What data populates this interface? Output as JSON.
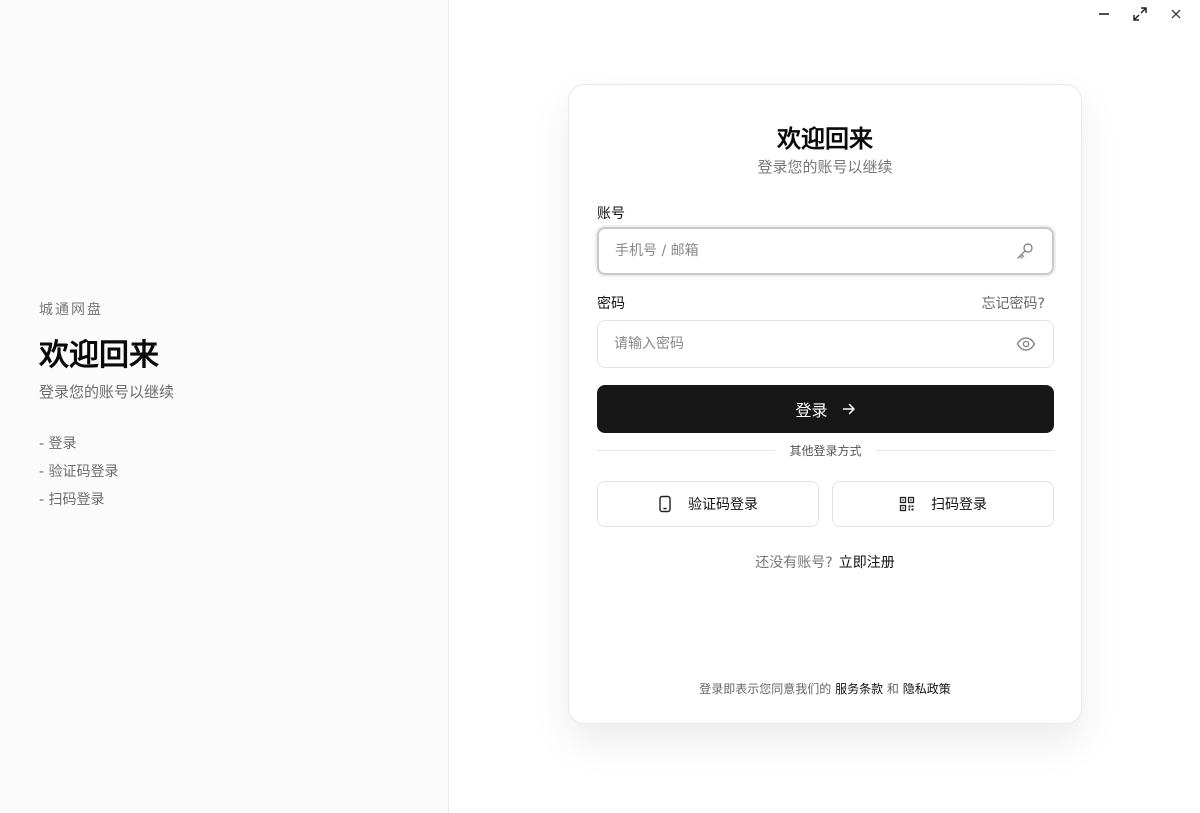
{
  "left": {
    "brand": "城通网盘",
    "title": "欢迎回来",
    "subtitle": "登录您的账号以继续",
    "features": [
      "- 登录",
      "- 验证码登录",
      "- 扫码登录"
    ]
  },
  "window_controls": {
    "minimize_icon": "minimize-icon",
    "maximize_icon": "maximize-icon",
    "close_icon": "close-icon"
  },
  "card": {
    "title": "欢迎回来",
    "subtitle": "登录您的账号以继续",
    "account": {
      "label": "账号",
      "placeholder": "手机号 / 邮箱",
      "value": "",
      "icon": "key-icon"
    },
    "password": {
      "label": "密码",
      "forgot": "忘记密码?",
      "placeholder": "请输入密码",
      "value": "",
      "icon": "eye-icon"
    },
    "login_button": "登录",
    "divider_text": "其他登录方式",
    "sms_login": "验证码登录",
    "qr_login": "扫码登录",
    "signup_prompt": "还没有账号?",
    "signup_link": "立即注册",
    "terms_prefix": "登录即表示您同意我们的",
    "terms_link": "服务条款",
    "terms_and": "和",
    "privacy_link": "隐私政策"
  },
  "colors": {
    "primary_button": "#171717",
    "left_panel_bg": "#fbfbfb",
    "border": "#e3e3e3"
  }
}
